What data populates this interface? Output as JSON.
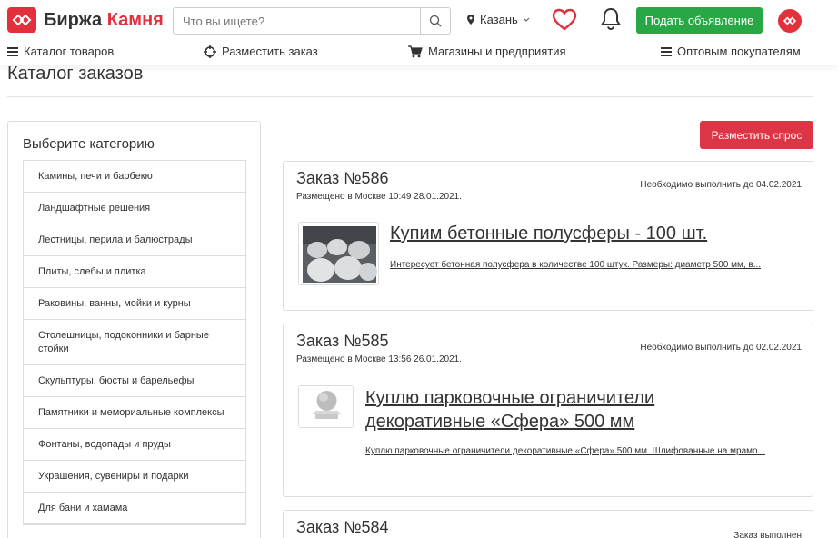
{
  "brand": {
    "name_part1": "Биржа",
    "name_part2": "Камня",
    "accent_color": "#e2303d"
  },
  "search": {
    "placeholder": "Что вы ищете?",
    "value": "",
    "icon": "search-icon"
  },
  "city": {
    "name": "Казань",
    "icon": "map-pin-icon"
  },
  "header": {
    "post_ad_label": "Подать объявление",
    "post_ad_color": "#28a745"
  },
  "nav": [
    {
      "label": "Каталог товаров",
      "icon": "menu-icon"
    },
    {
      "label": "Разместить заказ",
      "icon": "crosshair-icon"
    },
    {
      "label": "Магазины и предприятия",
      "icon": "cart-icon"
    },
    {
      "label": "Оптовым покупателям",
      "icon": "menu-icon"
    }
  ],
  "page": {
    "title": "Каталог заказов"
  },
  "sidebar": {
    "title": "Выберите категорию",
    "categories": [
      "Камины, печи и барбекю",
      "Ландшафтные решения",
      "Лестницы, перила и балюстрады",
      "Плиты, слебы и плитка",
      "Раковины, ванны, мойки и курны",
      "Столешницы, подоконники и барные стойки",
      "Скульптуры, бюсты и барельефы",
      "Памятники и мемориальные комплексы",
      "Фонтаны, водопады и пруды",
      "Украшения, сувениры и подарки",
      "Для бани и хамама"
    ]
  },
  "actions": {
    "place_demand_label": "Разместить спрос",
    "place_demand_color": "#dc3545"
  },
  "orders": [
    {
      "title": "Заказ №586",
      "posted": "Размещено в Москве 10:49 28.01.2021.",
      "deadline": "Необходимо выполнить до 04.02.2021",
      "heading": "Купим бетонные полусферы - 100 шт.",
      "description": "Интересует бетонная полусфера в количестве 100 штук. Размеры: диаметр 500 мм, в..."
    },
    {
      "title": "Заказ №585",
      "posted": "Размещено в Москве 13:56 26.01.2021.",
      "deadline": "Необходимо выполнить до 02.02.2021",
      "heading": "Куплю парковочные ограничители декоративные «Сфера» 500 мм",
      "description": "Куплю парковочные ограничители декоративные «Сфера» 500 мм. Шлифованные на мрамо..."
    },
    {
      "title": "Заказ №584",
      "deadline": "Заказ выполнен"
    }
  ]
}
